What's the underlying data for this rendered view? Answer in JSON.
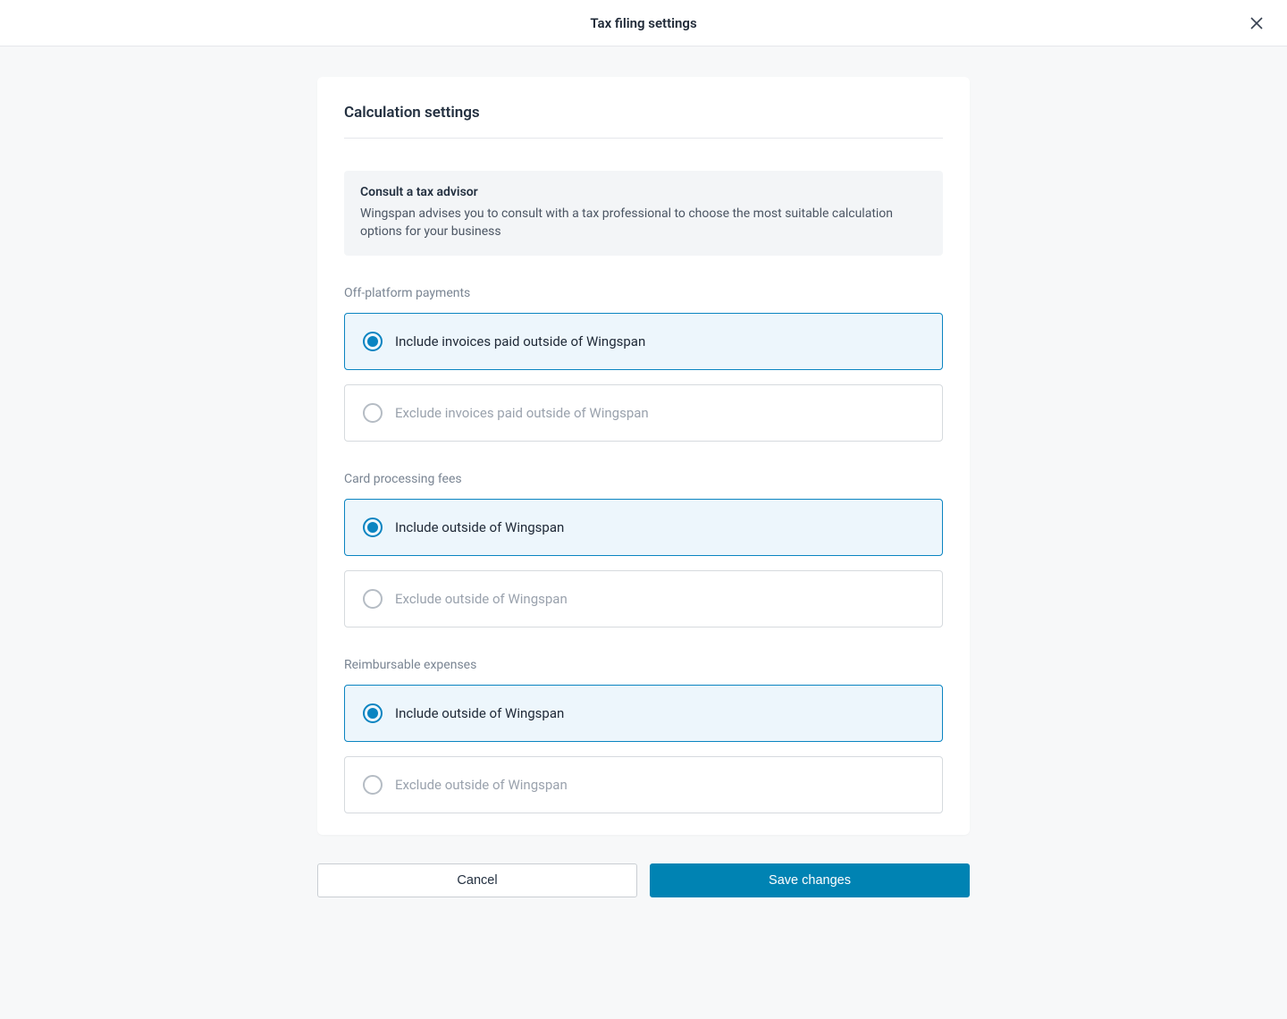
{
  "header": {
    "title": "Tax filing settings"
  },
  "card": {
    "title": "Calculation settings",
    "alert": {
      "title": "Consult a tax advisor",
      "text": "Wingspan advises you to consult with a tax professional to choose the most suitable calculation options for your business"
    },
    "groups": {
      "off_platform": {
        "label": "Off-platform payments",
        "option_include": "Include invoices paid outside of Wingspan",
        "option_exclude": "Exclude invoices paid outside of Wingspan",
        "selected": "include"
      },
      "card_fees": {
        "label": "Card processing fees",
        "option_include": "Include outside of Wingspan",
        "option_exclude": "Exclude outside of Wingspan",
        "selected": "include"
      },
      "reimbursable": {
        "label": "Reimbursable expenses",
        "option_include": "Include outside of Wingspan",
        "option_exclude": "Exclude outside of Wingspan",
        "selected": "include"
      }
    }
  },
  "buttons": {
    "cancel": "Cancel",
    "save": "Save changes"
  }
}
